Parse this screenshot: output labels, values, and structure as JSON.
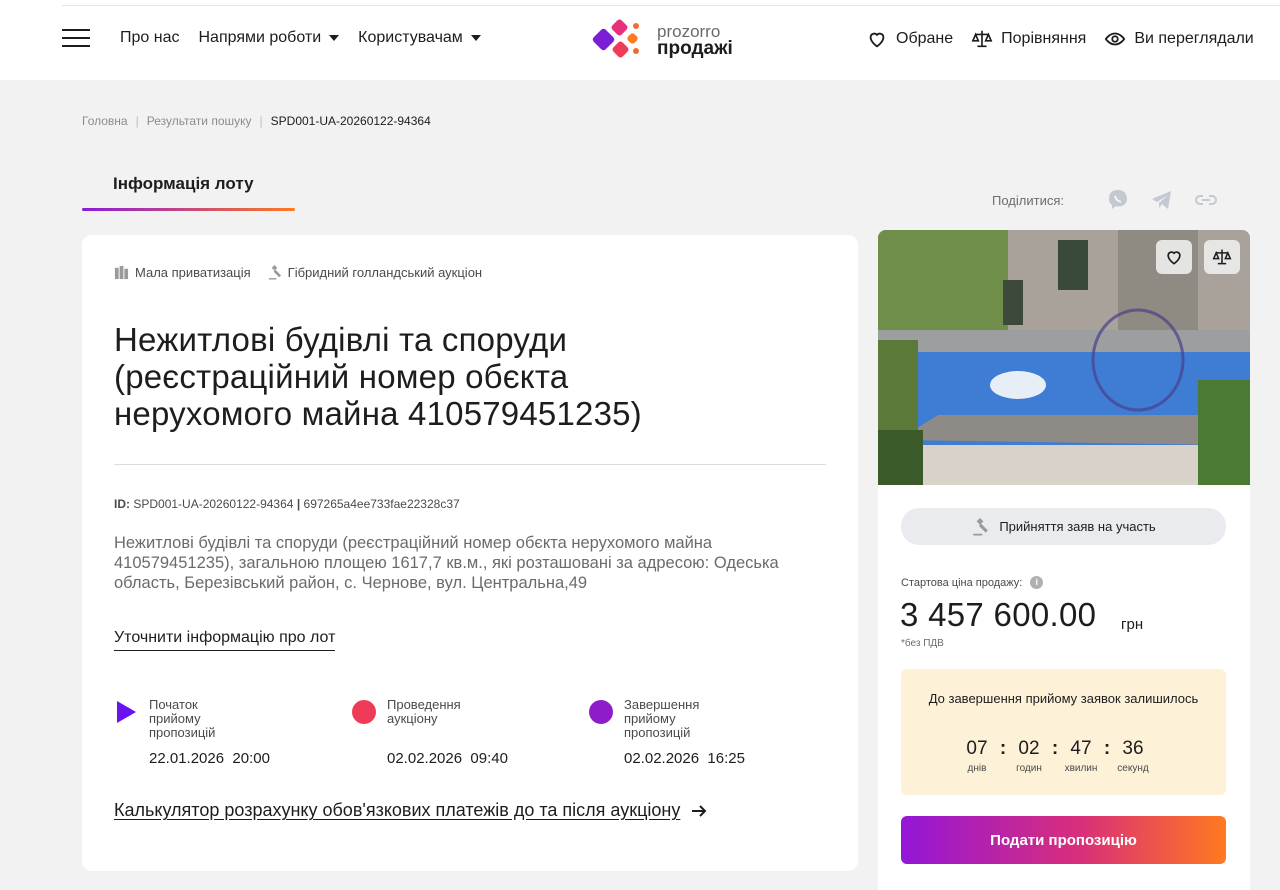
{
  "header": {
    "nav": [
      {
        "label": "Про нас",
        "has_dropdown": false
      },
      {
        "label": "Напрями роботи",
        "has_dropdown": true
      },
      {
        "label": "Користувачам",
        "has_dropdown": true
      }
    ],
    "logo": {
      "line1": "prozorro",
      "line2": "продажі"
    },
    "right": [
      {
        "label": "Обране",
        "icon": "heart-icon"
      },
      {
        "label": "Порівняння",
        "icon": "scales-icon"
      },
      {
        "label": "Ви переглядали",
        "icon": "eye-icon"
      }
    ]
  },
  "breadcrumb": {
    "home": "Головна",
    "results": "Результати пошуку",
    "current": "SPD001-UA-20260122-94364"
  },
  "tab": {
    "label": "Інформація лоту"
  },
  "share": {
    "label": "Поділитися:",
    "icons": [
      "viber-icon",
      "telegram-icon",
      "link-icon"
    ]
  },
  "lot": {
    "tags": [
      "Мала приватизація",
      "Гібридний голландський аукціон"
    ],
    "title": "Нежитлові будівлі та споруди (реєстраційний номер обєкта нерухомого майна 410579451235)",
    "id_prefix": "ID:",
    "id_value": "SPD001-UA-20260122-94364",
    "id_sep": "|",
    "id_hash": "697265a4ee733fae22328c37",
    "description": "Нежитлові будівлі та споруди (реєстраційний номер обєкта нерухомого майна 410579451235), загальною площею 1617,7 кв.м., які розташовані за адресою: Одеська область, Березівський район, с. Чернове, вул. Центральна,49",
    "more_link": "Уточнити інформацію про лот",
    "steps": [
      {
        "label": "Початок прийому пропозицій",
        "date": "22.01.2026  20:00",
        "color": "#6a12f0"
      },
      {
        "label": "Проведення аукціону",
        "date": "02.02.2026  09:40",
        "color": "#ee3b57"
      },
      {
        "label": "Завершення прийому пропозицій",
        "date": "02.02.2026  16:25",
        "color": "#8e1cc8"
      }
    ],
    "calc_link": "Калькулятор розрахунку обов'язкових платежів до та після аукціону"
  },
  "side": {
    "status": "Прийняття заяв на участь",
    "price_label": "Стартова ціна продажу:",
    "price": "3 457 600.00",
    "currency": "грн",
    "price_note": "*без ПДВ",
    "timer_title": "До завершення прийому заявок залишилось",
    "timer": [
      {
        "value": "07",
        "unit": "днів"
      },
      {
        "value": "02",
        "unit": "годин"
      },
      {
        "value": "47",
        "unit": "хвилин"
      },
      {
        "value": "36",
        "unit": "секунд"
      }
    ],
    "submit": "Подати пропозицію"
  },
  "colors": {
    "accent_purple": "#8a1bd8",
    "accent_orange": "#ff7a1f",
    "timer_bg": "#fdf1d8"
  }
}
